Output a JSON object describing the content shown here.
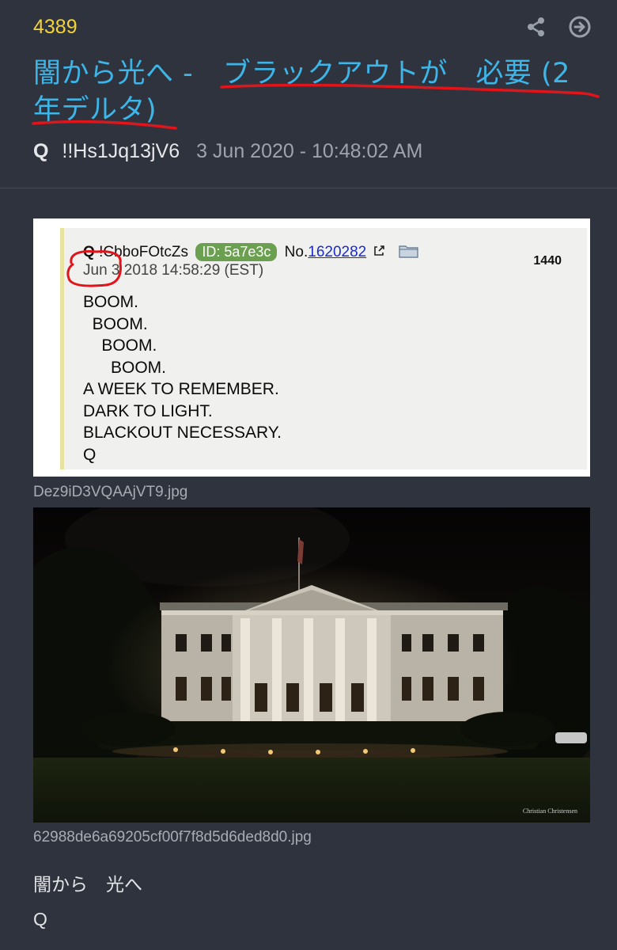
{
  "post": {
    "number": "4389",
    "title_part1": "闇から光へ - ",
    "title_part2": "ブラックアウトが　必要 (2",
    "title_part3": "年デルタ)",
    "author_name": "Q",
    "tripcode": "!!Hs1Jq13jV6",
    "timestamp": "3 Jun 2020 - 10:48:02 AM",
    "message_line1": "闇から　光へ",
    "message_line2": "Q"
  },
  "icons": {
    "share": "share-icon",
    "navigate": "arrow-right-circle-icon"
  },
  "attachments": [
    {
      "filename": "Dez9iD3VQAAjVT9.jpg",
      "quoted_post": {
        "name": "Q",
        "trip": "!CbboFOtcZs",
        "id_label": "ID: 5a7e3c",
        "no_prefix": "No.",
        "no": "1620282",
        "date_highlight": "Jun 3",
        "date_rest": " 2018 14:58:29 (EST)",
        "count": "1440",
        "body": "BOOM.\n  BOOM.\n    BOOM.\n      BOOM.\nA WEEK TO REMEMBER.\nDARK TO LIGHT.\nBLACKOUT NECESSARY.\nQ"
      }
    },
    {
      "filename": "62988de6a69205cf00f7f8d5d6ded8d0.jpg",
      "photo_credit": "Christian Christensen"
    }
  ],
  "colors": {
    "background": "#2f333d",
    "post_number": "#f3d23a",
    "title": "#3db5e8",
    "annotation_red": "#e0141b",
    "id_badge": "#6aa04f"
  }
}
